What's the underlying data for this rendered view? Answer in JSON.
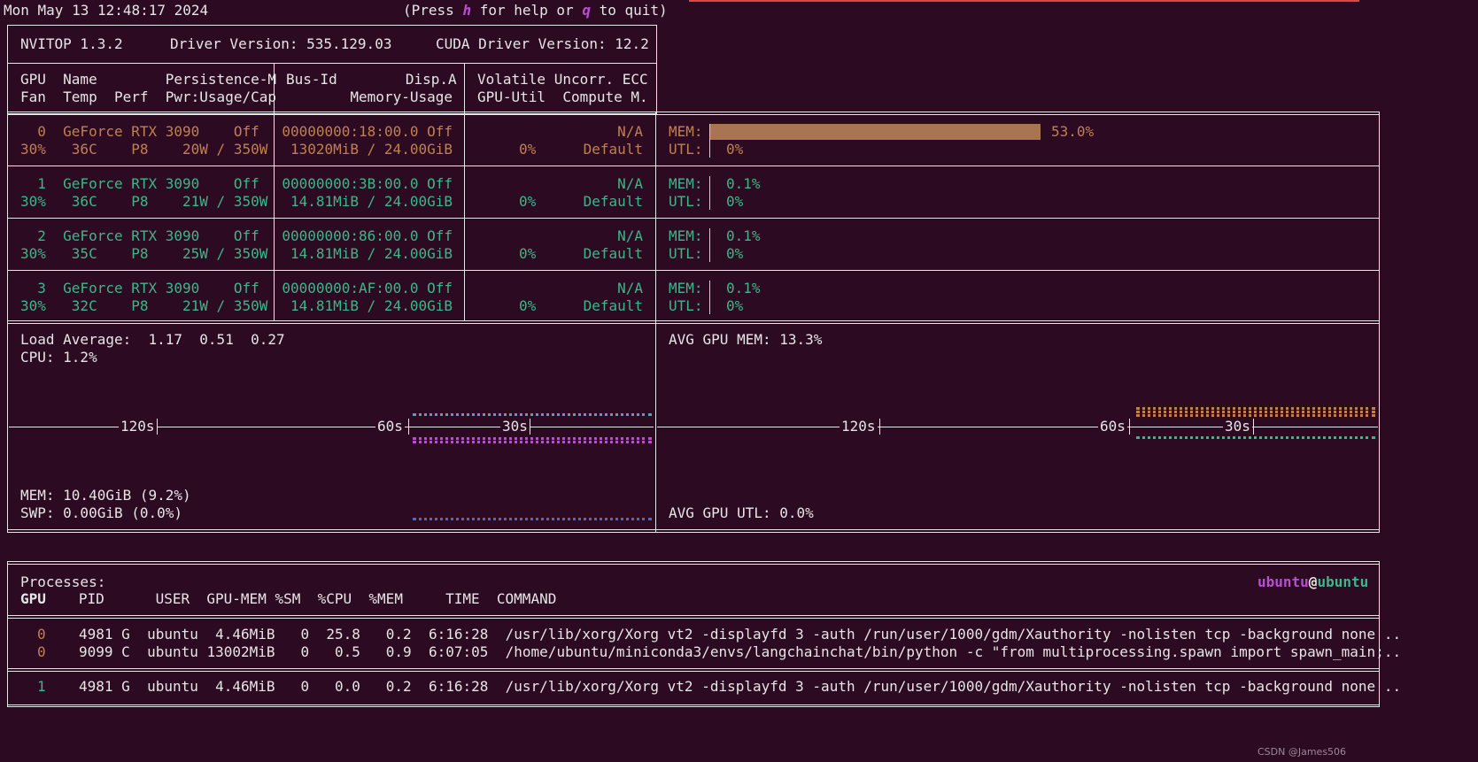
{
  "header": {
    "datetime": "Mon May 13 12:48:17 2024",
    "help_prefix": "(Press ",
    "help_key": "h",
    "help_mid": " for help or ",
    "quit_key": "q",
    "help_suffix": " to quit)"
  },
  "info": {
    "nvitop": "NVITOP 1.3.2",
    "driver": "Driver Version: 535.129.03",
    "cuda": "CUDA Driver Version: 12.2"
  },
  "columns": {
    "c1_l1": "GPU  Name        Persistence-M",
    "c1_l2": "Fan  Temp  Perf  Pwr:Usage/Cap",
    "c2_l1": "Bus-Id        Disp.A",
    "c2_l2": "Memory-Usage",
    "c3_l1": "Volatile Uncorr. ECC",
    "c3_l2": "GPU-Util  Compute M."
  },
  "gpus": [
    {
      "l1": "  0  GeForce RTX 3090    Off",
      "l2": "30%   36C    P8    20W / 350W",
      "bus": "00000000:18:00.0 Off",
      "mem": "13020MiB / 24.00GiB",
      "ecc": "N/A",
      "util": "0%",
      "compute": "Default",
      "mem_label": "MEM:",
      "mem_pct": "53.0%",
      "utl_label": "UTL:",
      "utl_pct": "0%",
      "mem_fraction": 0.53,
      "color": "orange"
    },
    {
      "l1": "  1  GeForce RTX 3090    Off",
      "l2": "30%   36C    P8    21W / 350W",
      "bus": "00000000:3B:00.0 Off",
      "mem": "14.81MiB / 24.00GiB",
      "ecc": "N/A",
      "util": "0%",
      "compute": "Default",
      "mem_label": "MEM:",
      "mem_pct": "0.1%",
      "utl_label": "UTL:",
      "utl_pct": "0%",
      "mem_fraction": 0.001,
      "color": "green"
    },
    {
      "l1": "  2  GeForce RTX 3090    Off",
      "l2": "30%   35C    P8    25W / 350W",
      "bus": "00000000:86:00.0 Off",
      "mem": "14.81MiB / 24.00GiB",
      "ecc": "N/A",
      "util": "0%",
      "compute": "Default",
      "mem_label": "MEM:",
      "mem_pct": "0.1%",
      "utl_label": "UTL:",
      "utl_pct": "0%",
      "mem_fraction": 0.001,
      "color": "green"
    },
    {
      "l1": "  3  GeForce RTX 3090    Off",
      "l2": "30%   32C    P8    21W / 350W",
      "bus": "00000000:AF:00.0 Off",
      "mem": "14.81MiB / 24.00GiB",
      "ecc": "N/A",
      "util": "0%",
      "compute": "Default",
      "mem_label": "MEM:",
      "mem_pct": "0.1%",
      "utl_label": "UTL:",
      "utl_pct": "0%",
      "mem_fraction": 0.001,
      "color": "green"
    }
  ],
  "host": {
    "load": "Load Average:  1.17  0.51  0.27",
    "cpu": "CPU: 1.2%",
    "mem": "MEM: 10.40GiB (9.2%)",
    "swp": "SWP: 0.00GiB (0.0%)",
    "axis": [
      "120s",
      "60s",
      "30s"
    ]
  },
  "gpu_summary": {
    "avg_mem": "AVG GPU MEM: 13.3%",
    "avg_utl": "AVG GPU UTL: 0.0%",
    "axis": [
      "120s",
      "60s",
      "30s"
    ]
  },
  "processes": {
    "title": "Processes:",
    "user": "ubuntu",
    "at": "@",
    "host": "ubuntu",
    "headers": {
      "gpu": "GPU",
      "rest": "   PID      USER  GPU-MEM %SM  %CPU  %MEM     TIME  COMMAND"
    },
    "rows": [
      {
        "gpu": "0",
        "rest": "4981 G  ubuntu  4.46MiB   0  25.8   0.2  6:16:28  /usr/lib/xorg/Xorg vt2 -displayfd 3 -auth /run/user/1000/gdm/Xauthority -nolisten tcp -background none ..",
        "color": "orange"
      },
      {
        "gpu": "0",
        "rest": "9099 C  ubuntu 13002MiB   0   0.5   0.9  6:07:05  /home/ubuntu/miniconda3/envs/langchainchat/bin/python -c \"from multiprocessing.spawn import spawn_main;..",
        "color": "orange"
      },
      {
        "gpu": "1",
        "rest": "4981 G  ubuntu  4.46MiB   0   0.0   0.2  6:16:28  /usr/lib/xorg/Xorg vt2 -displayfd 3 -auth /run/user/1000/gdm/Xauthority -nolisten tcp -background none ..",
        "color": "green"
      }
    ]
  },
  "watermark": "CSDN @James506",
  "colors": {
    "orange": "#c08052",
    "green": "#3fb58a",
    "purple": "#b84fd1",
    "blue": "#4a8fd6",
    "bar": "#a87552"
  }
}
